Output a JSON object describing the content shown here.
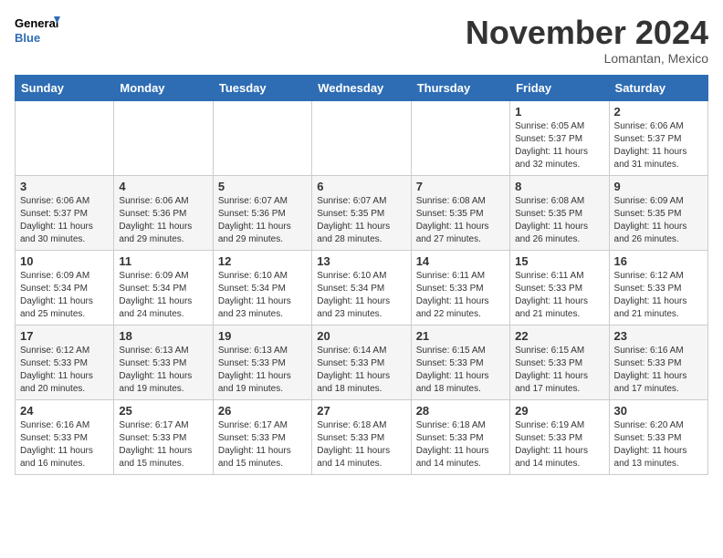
{
  "header": {
    "logo_line1": "General",
    "logo_line2": "Blue",
    "month": "November 2024",
    "location": "Lomantan, Mexico"
  },
  "weekdays": [
    "Sunday",
    "Monday",
    "Tuesday",
    "Wednesday",
    "Thursday",
    "Friday",
    "Saturday"
  ],
  "weeks": [
    [
      {
        "day": "",
        "info": ""
      },
      {
        "day": "",
        "info": ""
      },
      {
        "day": "",
        "info": ""
      },
      {
        "day": "",
        "info": ""
      },
      {
        "day": "",
        "info": ""
      },
      {
        "day": "1",
        "info": "Sunrise: 6:05 AM\nSunset: 5:37 PM\nDaylight: 11 hours\nand 32 minutes."
      },
      {
        "day": "2",
        "info": "Sunrise: 6:06 AM\nSunset: 5:37 PM\nDaylight: 11 hours\nand 31 minutes."
      }
    ],
    [
      {
        "day": "3",
        "info": "Sunrise: 6:06 AM\nSunset: 5:37 PM\nDaylight: 11 hours\nand 30 minutes."
      },
      {
        "day": "4",
        "info": "Sunrise: 6:06 AM\nSunset: 5:36 PM\nDaylight: 11 hours\nand 29 minutes."
      },
      {
        "day": "5",
        "info": "Sunrise: 6:07 AM\nSunset: 5:36 PM\nDaylight: 11 hours\nand 29 minutes."
      },
      {
        "day": "6",
        "info": "Sunrise: 6:07 AM\nSunset: 5:35 PM\nDaylight: 11 hours\nand 28 minutes."
      },
      {
        "day": "7",
        "info": "Sunrise: 6:08 AM\nSunset: 5:35 PM\nDaylight: 11 hours\nand 27 minutes."
      },
      {
        "day": "8",
        "info": "Sunrise: 6:08 AM\nSunset: 5:35 PM\nDaylight: 11 hours\nand 26 minutes."
      },
      {
        "day": "9",
        "info": "Sunrise: 6:09 AM\nSunset: 5:35 PM\nDaylight: 11 hours\nand 26 minutes."
      }
    ],
    [
      {
        "day": "10",
        "info": "Sunrise: 6:09 AM\nSunset: 5:34 PM\nDaylight: 11 hours\nand 25 minutes."
      },
      {
        "day": "11",
        "info": "Sunrise: 6:09 AM\nSunset: 5:34 PM\nDaylight: 11 hours\nand 24 minutes."
      },
      {
        "day": "12",
        "info": "Sunrise: 6:10 AM\nSunset: 5:34 PM\nDaylight: 11 hours\nand 23 minutes."
      },
      {
        "day": "13",
        "info": "Sunrise: 6:10 AM\nSunset: 5:34 PM\nDaylight: 11 hours\nand 23 minutes."
      },
      {
        "day": "14",
        "info": "Sunrise: 6:11 AM\nSunset: 5:33 PM\nDaylight: 11 hours\nand 22 minutes."
      },
      {
        "day": "15",
        "info": "Sunrise: 6:11 AM\nSunset: 5:33 PM\nDaylight: 11 hours\nand 21 minutes."
      },
      {
        "day": "16",
        "info": "Sunrise: 6:12 AM\nSunset: 5:33 PM\nDaylight: 11 hours\nand 21 minutes."
      }
    ],
    [
      {
        "day": "17",
        "info": "Sunrise: 6:12 AM\nSunset: 5:33 PM\nDaylight: 11 hours\nand 20 minutes."
      },
      {
        "day": "18",
        "info": "Sunrise: 6:13 AM\nSunset: 5:33 PM\nDaylight: 11 hours\nand 19 minutes."
      },
      {
        "day": "19",
        "info": "Sunrise: 6:13 AM\nSunset: 5:33 PM\nDaylight: 11 hours\nand 19 minutes."
      },
      {
        "day": "20",
        "info": "Sunrise: 6:14 AM\nSunset: 5:33 PM\nDaylight: 11 hours\nand 18 minutes."
      },
      {
        "day": "21",
        "info": "Sunrise: 6:15 AM\nSunset: 5:33 PM\nDaylight: 11 hours\nand 18 minutes."
      },
      {
        "day": "22",
        "info": "Sunrise: 6:15 AM\nSunset: 5:33 PM\nDaylight: 11 hours\nand 17 minutes."
      },
      {
        "day": "23",
        "info": "Sunrise: 6:16 AM\nSunset: 5:33 PM\nDaylight: 11 hours\nand 17 minutes."
      }
    ],
    [
      {
        "day": "24",
        "info": "Sunrise: 6:16 AM\nSunset: 5:33 PM\nDaylight: 11 hours\nand 16 minutes."
      },
      {
        "day": "25",
        "info": "Sunrise: 6:17 AM\nSunset: 5:33 PM\nDaylight: 11 hours\nand 15 minutes."
      },
      {
        "day": "26",
        "info": "Sunrise: 6:17 AM\nSunset: 5:33 PM\nDaylight: 11 hours\nand 15 minutes."
      },
      {
        "day": "27",
        "info": "Sunrise: 6:18 AM\nSunset: 5:33 PM\nDaylight: 11 hours\nand 14 minutes."
      },
      {
        "day": "28",
        "info": "Sunrise: 6:18 AM\nSunset: 5:33 PM\nDaylight: 11 hours\nand 14 minutes."
      },
      {
        "day": "29",
        "info": "Sunrise: 6:19 AM\nSunset: 5:33 PM\nDaylight: 11 hours\nand 14 minutes."
      },
      {
        "day": "30",
        "info": "Sunrise: 6:20 AM\nSunset: 5:33 PM\nDaylight: 11 hours\nand 13 minutes."
      }
    ]
  ]
}
